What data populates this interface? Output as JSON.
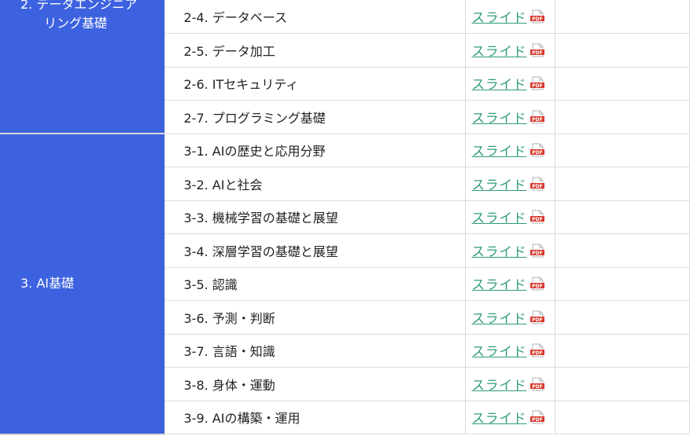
{
  "link_label": "スライド",
  "pdf_icon_text": "PDF",
  "sections": [
    {
      "label_line1": "2. データエンジニア",
      "label_line2": "リング基礎",
      "topics": [
        {
          "label": "2-4. データベース"
        },
        {
          "label": "2-5. データ加工"
        },
        {
          "label": "2-6. ITセキュリティ"
        },
        {
          "label": "2-7. プログラミング基礎"
        }
      ]
    },
    {
      "label_line1": "3. AI基礎",
      "topics": [
        {
          "label": "3-1. AIの歴史と応用分野"
        },
        {
          "label": "3-2. AIと社会"
        },
        {
          "label": "3-3. 機械学習の基礎と展望"
        },
        {
          "label": "3-4. 深層学習の基礎と展望"
        },
        {
          "label": "3-5. 認識"
        },
        {
          "label": "3-6. 予測・判断"
        },
        {
          "label": "3-7. 言語・知識"
        },
        {
          "label": "3-8. 身体・運動"
        },
        {
          "label": "3-9. AIの構築・運用"
        }
      ]
    }
  ],
  "colors": {
    "section_bg": "#3d62e0",
    "link": "#2e9b7a",
    "pdf_red": "#d83a2e"
  }
}
